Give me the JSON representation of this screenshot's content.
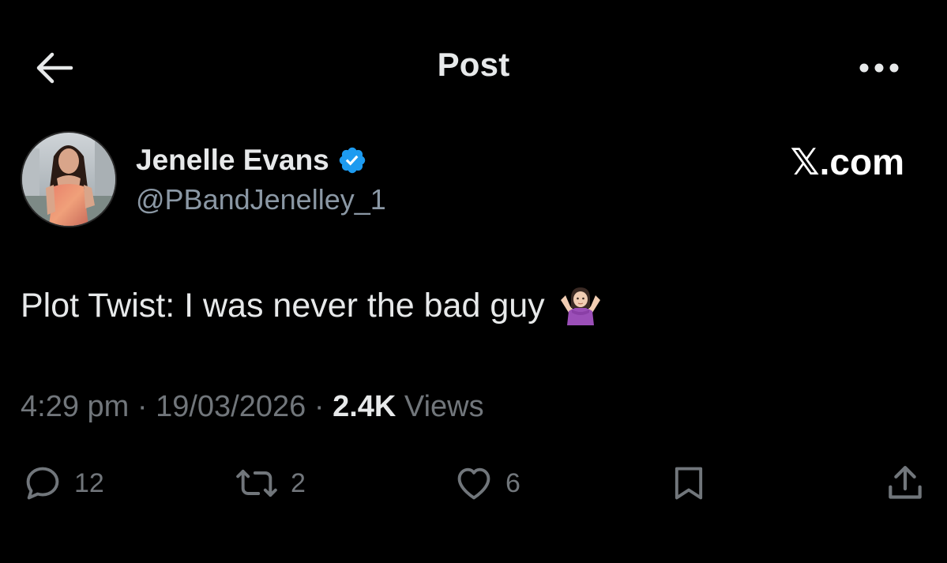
{
  "header": {
    "title": "Post",
    "back_icon": "arrow-left-icon",
    "more_icon": "more-horizontal-icon"
  },
  "watermark": "𝕏.com",
  "author": {
    "name": "Jenelle Evans",
    "handle": "@PBandJenelley_1",
    "verified": true,
    "verified_color": "#1d9bf0"
  },
  "post": {
    "text": "Plot Twist: I was never the bad guy",
    "emoji": "person-shrugging-emoji"
  },
  "meta": {
    "time": "4:29 pm",
    "separator": " · ",
    "date": "19/03/2026",
    "views_count": "2.4K",
    "views_label": "Views"
  },
  "actions": {
    "replies": "12",
    "reposts": "2",
    "likes": "6"
  },
  "colors": {
    "background": "#000000",
    "text_primary": "#e7e9ea",
    "text_secondary": "#71767b",
    "accent": "#1d9bf0"
  }
}
